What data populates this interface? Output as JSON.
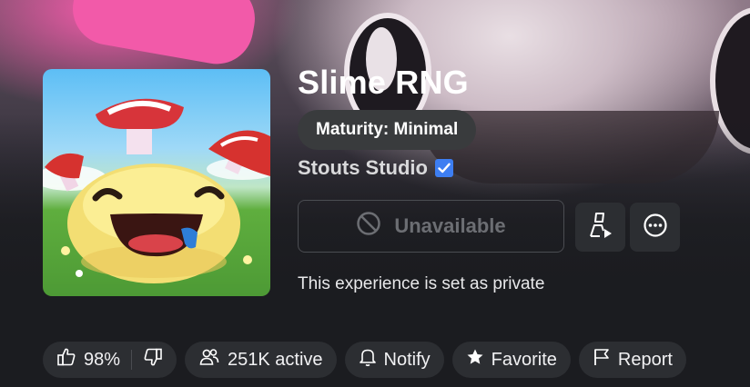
{
  "game": {
    "title": "Slime RNG",
    "maturity": "Maturity: Minimal",
    "creator": "Stouts Studio",
    "verified": true,
    "status_message": "This experience is set as private"
  },
  "actions": {
    "primary_label": "Unavailable",
    "primary_icon": "prohibited-icon",
    "secondary_icon": "party-play-icon",
    "more_icon": "more-options-icon"
  },
  "stats": {
    "rating": "98%",
    "active": "251K active",
    "notify": "Notify",
    "favorite": "Favorite",
    "report": "Report"
  },
  "colors": {
    "background": "#1b1c20",
    "pill": "#2c2e32",
    "verified_badge": "#3d7ef2",
    "disabled_text": "#6c6e73"
  }
}
